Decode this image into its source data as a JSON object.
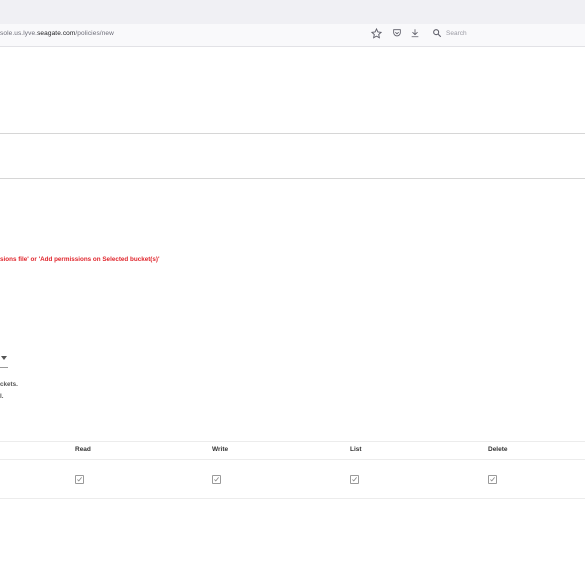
{
  "browser": {
    "url_prefix": "sole.us.lyve.",
    "url_domain": "seagate.com",
    "url_path": "/policies/new",
    "search_placeholder": "Search"
  },
  "page": {
    "error_message": "sions file' or 'Add permissions on Selected bucket(s)'",
    "note_line1": "ckets.",
    "note_line2": "l."
  },
  "permissions_table": {
    "columns": [
      "Read",
      "Write",
      "List",
      "Delete"
    ],
    "row": {
      "read": true,
      "write": true,
      "list": true,
      "delete": true
    }
  },
  "colors": {
    "error": "#e0242b",
    "divider": "#d6d6d6"
  }
}
